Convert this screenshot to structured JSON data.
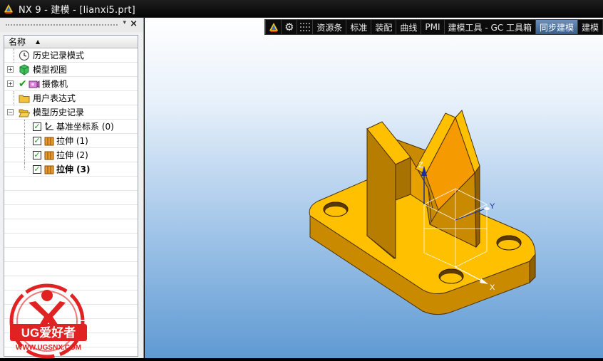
{
  "window": {
    "title": "NX 9 - 建模 - [lianxi5.prt]"
  },
  "navigator": {
    "column_header": "名称",
    "items": [
      {
        "label": "历史记录模式",
        "icon": "clock-icon"
      },
      {
        "label": "模型视图",
        "icon": "cube-view-icon"
      },
      {
        "label": "摄像机",
        "icon": "camera-icon"
      },
      {
        "label": "用户表达式",
        "icon": "folder-icon"
      },
      {
        "label": "模型历史记录",
        "icon": "folder-open-icon"
      },
      {
        "label": "基准坐标系 (0)",
        "icon": "datum-csys-icon"
      },
      {
        "label": "拉伸 (1)",
        "icon": "extrude-icon"
      },
      {
        "label": "拉伸 (2)",
        "icon": "extrude-icon"
      },
      {
        "label": "拉伸 (3)",
        "icon": "extrude-icon"
      }
    ]
  },
  "toolbar": {
    "tabs": [
      "资源条",
      "标准",
      "装配",
      "曲线",
      "PMI",
      "建模工具 - GC 工具箱",
      "同步建模",
      "建模"
    ],
    "active_tab": "同步建模"
  },
  "viewport": {
    "triad": {
      "z_label": "Z",
      "y_label": "Y",
      "x_label": "X"
    }
  },
  "watermark": {
    "brand": "UG爱好者",
    "url": "WWW.UGSNX.COM"
  },
  "colors": {
    "part_top": "#ffc000",
    "part_side": "#c98a00",
    "part_dark": "#8f5f00",
    "active_tab": "#4f79a7",
    "watermark_red": "#e02222"
  }
}
